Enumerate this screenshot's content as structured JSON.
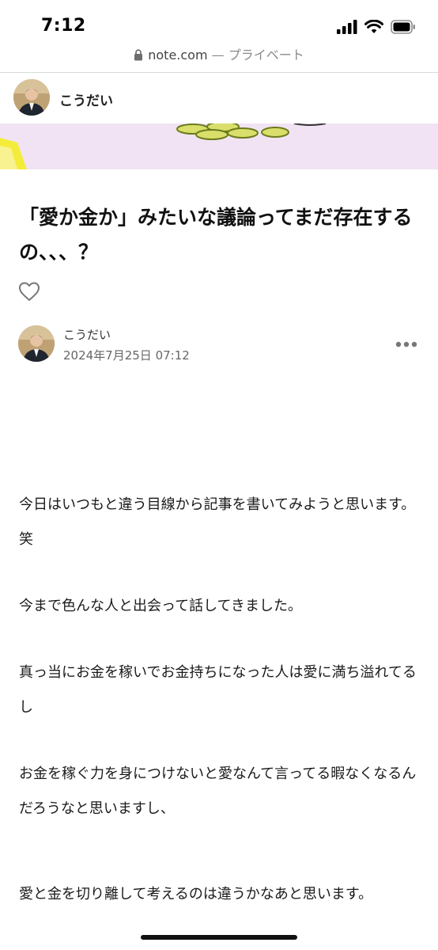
{
  "status_bar": {
    "time": "7:12"
  },
  "browser": {
    "domain": "note.com",
    "privacy_label": " — プライベート"
  },
  "header": {
    "author_name": "こうだい"
  },
  "article": {
    "title": "「愛か金か」みたいな議論ってまだ存在するの、、、？",
    "author_name": "こうだい",
    "date": "2024年7月25日 07:12",
    "paragraphs": [
      "今日はいつもと違う目線から記事を書いてみようと思います。笑",
      "今まで色んな人と出会って話してきました。",
      "真っ当にお金を稼いでお金持ちになった人は愛に満ち溢れてるし",
      "お金を稼ぐ力を身につけないと愛なんて言ってる暇なくなるんだろうなと思いますし、",
      "愛と金を切り離して考えるのは違うかなあと思います。"
    ]
  },
  "icons": {
    "signal": "cellular-signal-icon",
    "wifi": "wifi-icon",
    "battery": "battery-icon",
    "lock": "lock-icon",
    "like": "heart-icon",
    "more": "more-horizontal-icon"
  },
  "colors": {
    "hero_background": "#f1e3f3",
    "hero_accent": "#f4ec3a",
    "coin": "#d9df6a"
  }
}
